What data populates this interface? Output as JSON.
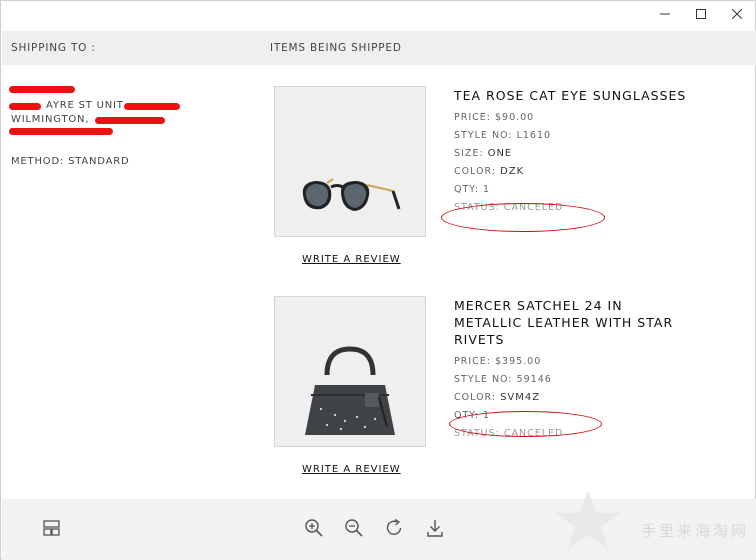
{
  "header": {
    "shipping_to": "SHIPPING TO :",
    "items_being_shipped": "ITEMS BEING SHIPPED"
  },
  "address": {
    "street_partial": "AYRE ST UNIT",
    "city_partial": "WILMINGTON,",
    "method": "METHOD: STANDARD"
  },
  "items": [
    {
      "name": "TEA ROSE CAT EYE SUNGLASSES",
      "price": "PRICE: $90.00",
      "style_label": "STYLE NO: ",
      "style_value": "L1610",
      "size_label": "SIZE: ",
      "size_value": "ONE",
      "color_label": "COLOR: ",
      "color_value": "DZK",
      "qty": "QTY: 1",
      "status": "STATUS: CANCELED",
      "review_link": "WRITE A REVIEW",
      "image_icon": "sunglasses-icon"
    },
    {
      "name": "MERCER SATCHEL 24 IN METALLIC LEATHER WITH STAR RIVETS",
      "price": "PRICE: $395.00",
      "style_label": "STYLE NO: ",
      "style_value": "59146",
      "color_label": "COLOR: ",
      "color_value": "SVM4Z",
      "qty": "QTY: 1",
      "status": "STATUS: CANCELED",
      "review_link": "WRITE A REVIEW",
      "image_icon": "handbag-icon"
    }
  ],
  "toolbar": {
    "icons": [
      "layout-icon",
      "zoom-in-icon",
      "zoom-out-icon",
      "rotate-icon",
      "download-icon"
    ]
  },
  "watermark": {
    "text": "手里来海淘网"
  },
  "colors": {
    "redaction": "#ee1111",
    "annotation": "#cc1111",
    "header_bg": "#efefef"
  }
}
